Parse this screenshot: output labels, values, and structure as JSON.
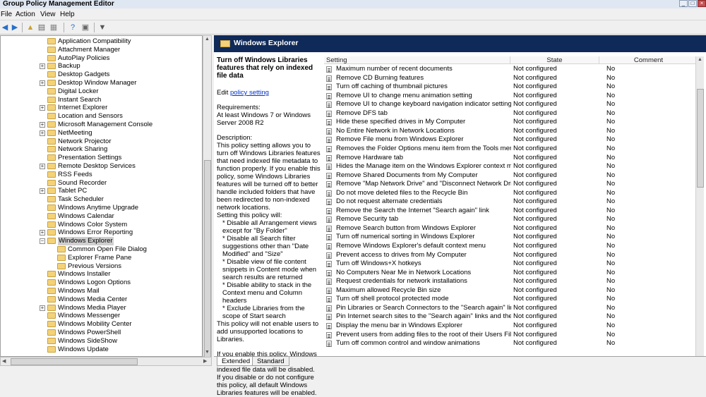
{
  "window": {
    "title": "Group Policy Management Editor"
  },
  "menu": [
    "File",
    "Action",
    "View",
    "Help"
  ],
  "tree": {
    "items": [
      {
        "label": "Application Compatibility",
        "level": 1,
        "expander": ""
      },
      {
        "label": "Attachment Manager",
        "level": 1,
        "expander": ""
      },
      {
        "label": "AutoPlay Policies",
        "level": 1,
        "expander": ""
      },
      {
        "label": "Backup",
        "level": 1,
        "expander": "+"
      },
      {
        "label": "Desktop Gadgets",
        "level": 1,
        "expander": ""
      },
      {
        "label": "Desktop Window Manager",
        "level": 1,
        "expander": "+"
      },
      {
        "label": "Digital Locker",
        "level": 1,
        "expander": ""
      },
      {
        "label": "Instant Search",
        "level": 1,
        "expander": ""
      },
      {
        "label": "Internet Explorer",
        "level": 1,
        "expander": "+"
      },
      {
        "label": "Location and Sensors",
        "level": 1,
        "expander": ""
      },
      {
        "label": "Microsoft Management Console",
        "level": 1,
        "expander": "+"
      },
      {
        "label": "NetMeeting",
        "level": 1,
        "expander": "+"
      },
      {
        "label": "Network Projector",
        "level": 1,
        "expander": ""
      },
      {
        "label": "Network Sharing",
        "level": 1,
        "expander": ""
      },
      {
        "label": "Presentation Settings",
        "level": 1,
        "expander": ""
      },
      {
        "label": "Remote Desktop Services",
        "level": 1,
        "expander": "+"
      },
      {
        "label": "RSS Feeds",
        "level": 1,
        "expander": ""
      },
      {
        "label": "Sound Recorder",
        "level": 1,
        "expander": ""
      },
      {
        "label": "Tablet PC",
        "level": 1,
        "expander": "+"
      },
      {
        "label": "Task Scheduler",
        "level": 1,
        "expander": ""
      },
      {
        "label": "Windows Anytime Upgrade",
        "level": 1,
        "expander": ""
      },
      {
        "label": "Windows Calendar",
        "level": 1,
        "expander": ""
      },
      {
        "label": "Windows Color System",
        "level": 1,
        "expander": ""
      },
      {
        "label": "Windows Error Reporting",
        "level": 1,
        "expander": "+"
      },
      {
        "label": "Windows Explorer",
        "level": 1,
        "expander": "-",
        "selected": true
      },
      {
        "label": "Common Open File Dialog",
        "level": 2,
        "expander": ""
      },
      {
        "label": "Explorer Frame Pane",
        "level": 2,
        "expander": ""
      },
      {
        "label": "Previous Versions",
        "level": 2,
        "expander": ""
      },
      {
        "label": "Windows Installer",
        "level": 1,
        "expander": ""
      },
      {
        "label": "Windows Logon Options",
        "level": 1,
        "expander": ""
      },
      {
        "label": "Windows Mail",
        "level": 1,
        "expander": ""
      },
      {
        "label": "Windows Media Center",
        "level": 1,
        "expander": ""
      },
      {
        "label": "Windows Media Player",
        "level": 1,
        "expander": "+"
      },
      {
        "label": "Windows Messenger",
        "level": 1,
        "expander": ""
      },
      {
        "label": "Windows Mobility Center",
        "level": 1,
        "expander": ""
      },
      {
        "label": "Windows PowerShell",
        "level": 1,
        "expander": ""
      },
      {
        "label": "Windows SideShow",
        "level": 1,
        "expander": ""
      },
      {
        "label": "Windows Update",
        "level": 1,
        "expander": ""
      }
    ]
  },
  "pane": {
    "header": "Windows Explorer",
    "description": {
      "title": "Turn off Windows Libraries features that rely on indexed file data",
      "edit_prefix": "Edit",
      "edit_link": "policy setting",
      "requirements_label": "Requirements:",
      "requirements_text": "At least Windows 7 or Windows Server 2008 R2",
      "description_label": "Description:",
      "body": "This policy setting allows you to turn off Windows Libraries features that need indexed file metadata to function properly.  If you enable this policy, some Windows Libraries features will be turned off to better handle included folders that have been redirected to non-indexed network locations.",
      "will_label": "Setting this policy will:",
      "bullets": [
        "* Disable all Arrangement views except for \"By Folder\"",
        "* Disable all Search filter suggestions other than \"Date Modified\" and \"Size\"",
        "* Disable view of file content snippets in Content mode when search results are returned",
        "* Disable ability to stack in the Context menu and Column headers",
        "* Exclude Libraries from the scope of Start search"
      ],
      "note": "This policy will not enable users to add unsupported locations to Libraries.",
      "enabled_text": "If you enable this policy, Windows Libraries features that rely on indexed file data will be disabled.",
      "disabled_text": "If you disable or do not configure this policy, all default Windows Libraries features will be enabled."
    },
    "columns": {
      "setting": "Setting",
      "state": "State",
      "comment": "Comment"
    },
    "rows": [
      {
        "setting": "Maximum number of recent documents",
        "state": "Not configured",
        "comment": "No"
      },
      {
        "setting": "Remove CD Burning features",
        "state": "Not configured",
        "comment": "No"
      },
      {
        "setting": "Turn off caching of thumbnail pictures",
        "state": "Not configured",
        "comment": "No"
      },
      {
        "setting": "Remove UI to change menu animation setting",
        "state": "Not configured",
        "comment": "No"
      },
      {
        "setting": "Remove UI to change keyboard navigation indicator setting",
        "state": "Not configured",
        "comment": "No"
      },
      {
        "setting": "Remove DFS tab",
        "state": "Not configured",
        "comment": "No"
      },
      {
        "setting": "Hide these specified drives in My Computer",
        "state": "Not configured",
        "comment": "No"
      },
      {
        "setting": "No Entire Network in Network Locations",
        "state": "Not configured",
        "comment": "No"
      },
      {
        "setting": "Remove File menu from Windows Explorer",
        "state": "Not configured",
        "comment": "No"
      },
      {
        "setting": "Removes the Folder Options menu item from the Tools menu",
        "state": "Not configured",
        "comment": "No"
      },
      {
        "setting": "Remove Hardware tab",
        "state": "Not configured",
        "comment": "No"
      },
      {
        "setting": "Hides the Manage item on the Windows Explorer context menu",
        "state": "Not configured",
        "comment": "No"
      },
      {
        "setting": "Remove Shared Documents from My Computer",
        "state": "Not configured",
        "comment": "No"
      },
      {
        "setting": "Remove \"Map Network Drive\" and \"Disconnect Network Drive\"",
        "state": "Not configured",
        "comment": "No"
      },
      {
        "setting": "Do not move deleted files to the Recycle Bin",
        "state": "Not configured",
        "comment": "No"
      },
      {
        "setting": "Do not request alternate credentials",
        "state": "Not configured",
        "comment": "No"
      },
      {
        "setting": "Remove the Search the Internet \"Search again\" link",
        "state": "Not configured",
        "comment": "No"
      },
      {
        "setting": "Remove Security tab",
        "state": "Not configured",
        "comment": "No"
      },
      {
        "setting": "Remove Search button from Windows Explorer",
        "state": "Not configured",
        "comment": "No"
      },
      {
        "setting": "Turn off numerical sorting in Windows Explorer",
        "state": "Not configured",
        "comment": "No"
      },
      {
        "setting": "Remove Windows Explorer's default context menu",
        "state": "Not configured",
        "comment": "No"
      },
      {
        "setting": "Prevent access to drives from My Computer",
        "state": "Not configured",
        "comment": "No"
      },
      {
        "setting": "Turn off Windows+X hotkeys",
        "state": "Not configured",
        "comment": "No"
      },
      {
        "setting": "No Computers Near Me in Network Locations",
        "state": "Not configured",
        "comment": "No"
      },
      {
        "setting": "Request credentials for network installations",
        "state": "Not configured",
        "comment": "No"
      },
      {
        "setting": "Maximum allowed Recycle Bin size",
        "state": "Not configured",
        "comment": "No"
      },
      {
        "setting": "Turn off shell protocol protected mode",
        "state": "Not configured",
        "comment": "No"
      },
      {
        "setting": "Pin Libraries or Search Connectors to the \"Search again\" links and...",
        "state": "Not configured",
        "comment": "No"
      },
      {
        "setting": "Pin Internet search sites to the \"Search again\" links and the Start...",
        "state": "Not configured",
        "comment": "No"
      },
      {
        "setting": "Display the menu bar in Windows Explorer",
        "state": "Not configured",
        "comment": "No"
      },
      {
        "setting": "Prevent users from adding files to the root of their Users Files fol...",
        "state": "Not configured",
        "comment": "No"
      },
      {
        "setting": "Turn off common control and window animations",
        "state": "Not configured",
        "comment": "No"
      }
    ]
  },
  "tabs": [
    "Extended",
    "Standard"
  ],
  "colors": {
    "header_band": "#0f2a58",
    "link": "#0033cc",
    "selection": "#cfcfcf"
  }
}
